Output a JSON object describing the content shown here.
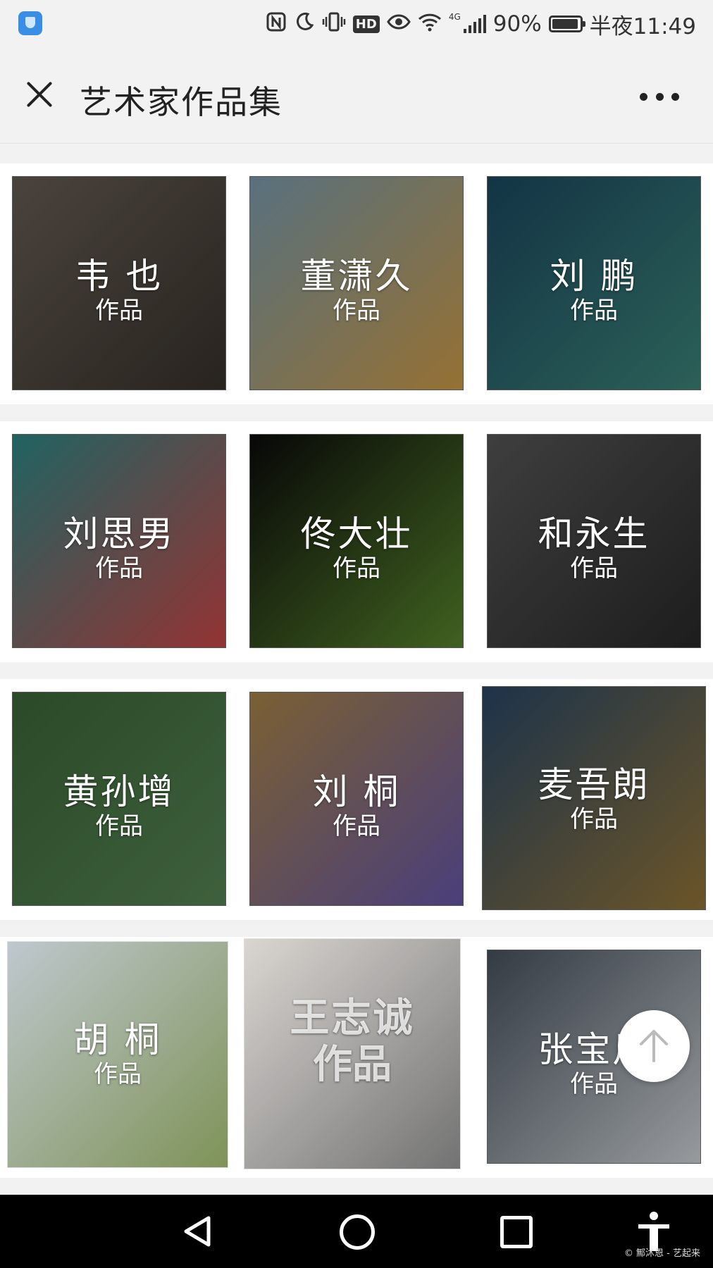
{
  "status_bar": {
    "battery": "90%",
    "time": "半夜11:49",
    "network_label": "4G",
    "battery_level": 0.9,
    "icons": [
      "app-shield-icon",
      "nfc-icon",
      "moon-icon",
      "vibrate-icon",
      "hd-icon",
      "eye-icon",
      "wifi-icon",
      "signal-icon",
      "battery-icon"
    ]
  },
  "header": {
    "title": "艺术家作品集",
    "close_icon": "close-icon",
    "more_icon": "more-icon"
  },
  "artists": [
    {
      "name": "韦 也",
      "sub": "作品",
      "colors": [
        "#6b6158",
        "#3a332d"
      ]
    },
    {
      "name": "董潇久",
      "sub": "作品",
      "colors": [
        "#7fa3b5",
        "#d6a24a"
      ]
    },
    {
      "name": "刘 鹏",
      "sub": "作品",
      "colors": [
        "#1c4b63",
        "#3f8a7e"
      ]
    },
    {
      "name": "刘思男",
      "sub": "作品",
      "colors": [
        "#2f8f8d",
        "#d44a4a"
      ]
    },
    {
      "name": "佟大壮",
      "sub": "作品",
      "colors": [
        "#0b0b0b",
        "#5c8c2e"
      ]
    },
    {
      "name": "和永生",
      "sub": "作品",
      "colors": [
        "#5a5a5a",
        "#2a2a2a"
      ]
    },
    {
      "name": "黄孙增",
      "sub": "作品",
      "colors": [
        "#3e6b3a",
        "#5a8a56"
      ]
    },
    {
      "name": "刘 桐",
      "sub": "作品",
      "colors": [
        "#b08a4a",
        "#6a5ab0"
      ]
    },
    {
      "name": "麦吾朗",
      "sub": "作品",
      "colors": [
        "#2a4a6a",
        "#9a7a3a"
      ]
    },
    {
      "name": "胡 桐",
      "sub": "作品",
      "colors": [
        "#cfd9e0",
        "#8aa060"
      ]
    },
    {
      "name": "王志诚",
      "sub": "作品",
      "colors": [
        "#e8e4df",
        "#7a7a7a"
      ]
    },
    {
      "name": "张宝川",
      "sub": "作品",
      "colors": [
        "#4a5560",
        "#d8dde2"
      ]
    }
  ],
  "fab": {
    "icon": "arrow-up-icon"
  },
  "nav_bar": {
    "icons": [
      "back-triangle-icon",
      "home-circle-icon",
      "recents-square-icon",
      "accessibility-icon"
    ]
  },
  "watermark": "© 鄦沭恩 - 艺起来"
}
